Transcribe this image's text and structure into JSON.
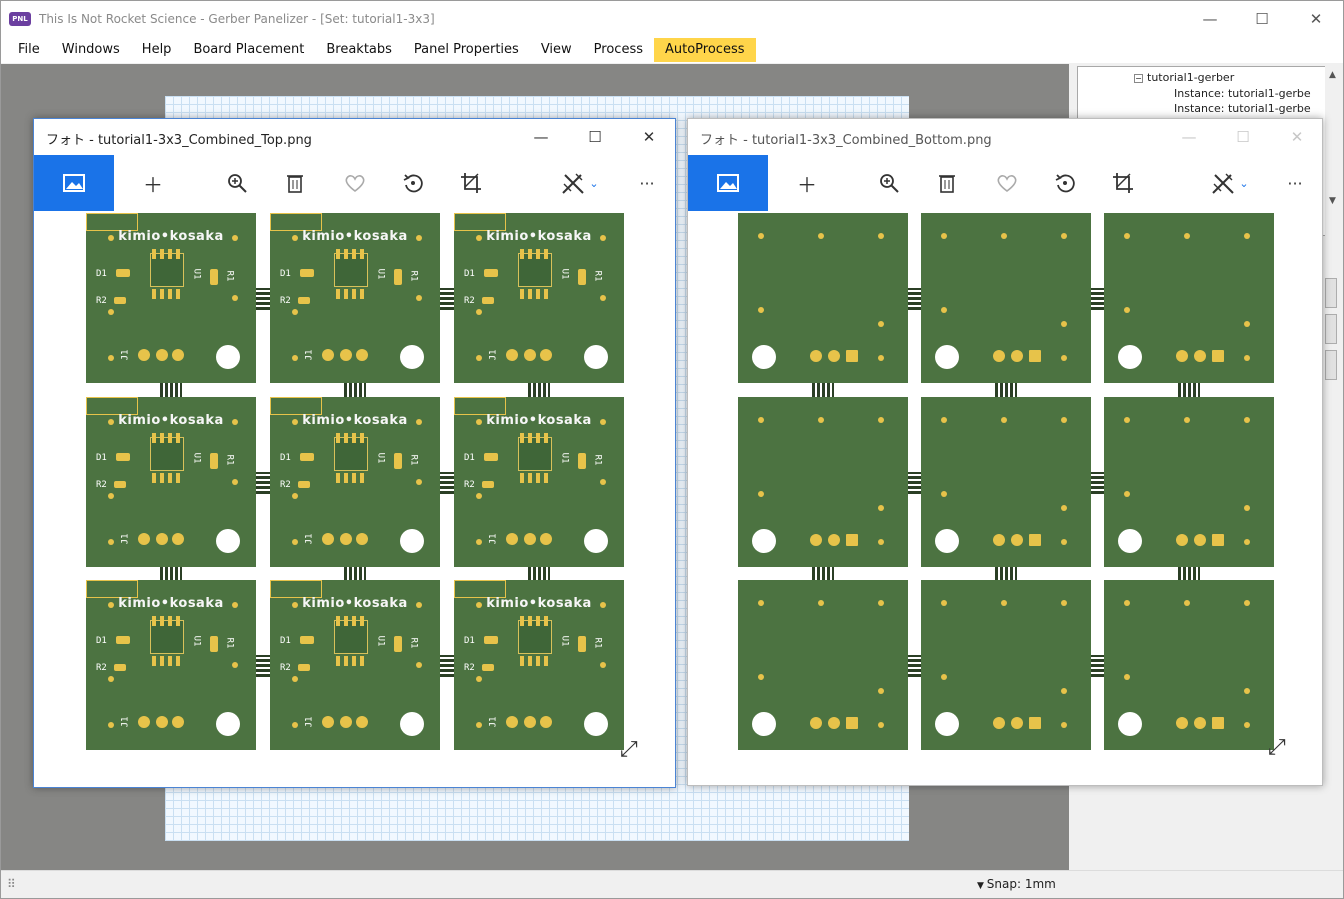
{
  "app": {
    "logo_text": "PNL",
    "title": "This Is Not Rocket Science - Gerber Panelizer - [Set: tutorial1-3x3]"
  },
  "window_controls": {
    "minimize": "—",
    "maximize": "☐",
    "close": "✕"
  },
  "menu": [
    {
      "label": "File"
    },
    {
      "label": "Windows"
    },
    {
      "label": "Help"
    },
    {
      "label": "Board Placement"
    },
    {
      "label": "Breaktabs"
    },
    {
      "label": "Panel Properties"
    },
    {
      "label": "View"
    },
    {
      "label": "Process"
    },
    {
      "label": "AutoProcess",
      "highlighted": true
    }
  ],
  "tree": {
    "root": "tutorial1-gerber",
    "children": [
      "Instance: tutorial1-gerbe",
      "Instance: tutorial1-gerbe"
    ]
  },
  "status": {
    "snap": "Snap: 1mm"
  },
  "photo_top": {
    "title": "フォト - tutorial1-3x3_Combined_Top.png",
    "board_label": "kimio•kosaka",
    "labels": {
      "d1": "D1",
      "r2": "R2",
      "u1": "U1",
      "r1": "R1",
      "j1": "J1"
    }
  },
  "photo_bottom": {
    "title": "フォト - tutorial1-3x3_Combined_Bottom.png"
  },
  "colors": {
    "pcb_green": "#4c7341",
    "pad_gold": "#e7c34a",
    "accent_blue": "#1a73e8",
    "autoprocess_yellow": "#ffd54a"
  },
  "icons": [
    "image-icon",
    "add-icon",
    "zoom-icon",
    "delete-icon",
    "heart-icon",
    "rotate-icon",
    "crop-icon",
    "edit-icon",
    "more-icon"
  ]
}
